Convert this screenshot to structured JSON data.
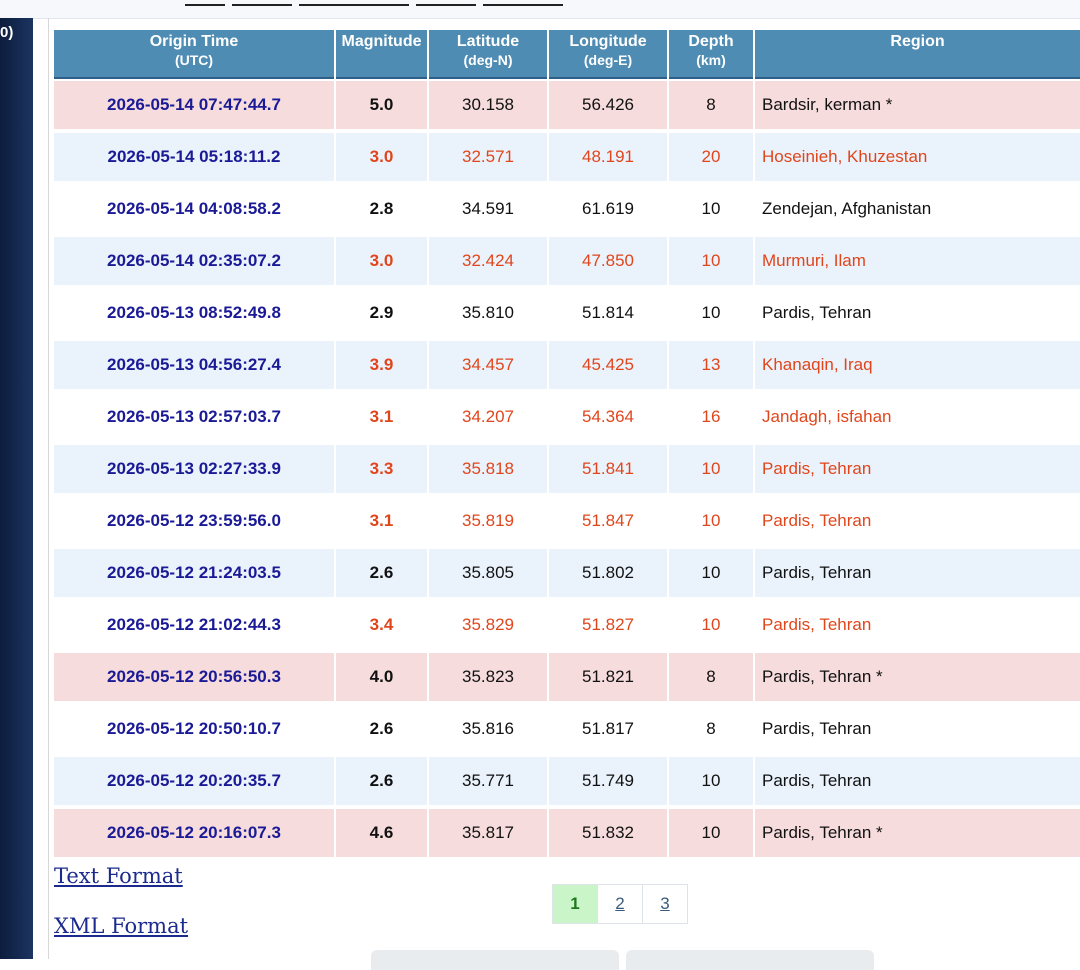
{
  "sidebar": {
    "corner_label": "0)"
  },
  "table": {
    "headers": {
      "time": "Origin Time",
      "time_unit": "(UTC)",
      "magnitude": "Magnitude",
      "latitude": "Latitude",
      "latitude_unit": "(deg-N)",
      "longitude": "Longitude",
      "longitude_unit": "(deg-E)",
      "depth": "Depth",
      "depth_unit": "(km)",
      "region": "Region"
    },
    "rows": [
      {
        "time": "2026-05-14 07:47:44.7",
        "mag": "5.0",
        "lat": "30.158",
        "lon": "56.426",
        "depth": "8",
        "region": "Bardsir, kerman *",
        "style": "big"
      },
      {
        "time": "2026-05-14 05:18:11.2",
        "mag": "3.0",
        "lat": "32.571",
        "lon": "48.191",
        "depth": "20",
        "region": "Hoseinieh, Khuzestan",
        "style": "alt orange"
      },
      {
        "time": "2026-05-14 04:08:58.2",
        "mag": "2.8",
        "lat": "34.591",
        "lon": "61.619",
        "depth": "10",
        "region": "Zendejan, Afghanistan",
        "style": "plain"
      },
      {
        "time": "2026-05-14 02:35:07.2",
        "mag": "3.0",
        "lat": "32.424",
        "lon": "47.850",
        "depth": "10",
        "region": "Murmuri, Ilam",
        "style": "alt orange"
      },
      {
        "time": "2026-05-13 08:52:49.8",
        "mag": "2.9",
        "lat": "35.810",
        "lon": "51.814",
        "depth": "10",
        "region": "Pardis, Tehran",
        "style": "plain"
      },
      {
        "time": "2026-05-13 04:56:27.4",
        "mag": "3.9",
        "lat": "34.457",
        "lon": "45.425",
        "depth": "13",
        "region": "Khanaqin, Iraq",
        "style": "alt orange"
      },
      {
        "time": "2026-05-13 02:57:03.7",
        "mag": "3.1",
        "lat": "34.207",
        "lon": "54.364",
        "depth": "16",
        "region": "Jandagh, isfahan",
        "style": "plain orange"
      },
      {
        "time": "2026-05-13 02:27:33.9",
        "mag": "3.3",
        "lat": "35.818",
        "lon": "51.841",
        "depth": "10",
        "region": "Pardis, Tehran",
        "style": "alt orange"
      },
      {
        "time": "2026-05-12 23:59:56.0",
        "mag": "3.1",
        "lat": "35.819",
        "lon": "51.847",
        "depth": "10",
        "region": "Pardis, Tehran",
        "style": "plain orange"
      },
      {
        "time": "2026-05-12 21:24:03.5",
        "mag": "2.6",
        "lat": "35.805",
        "lon": "51.802",
        "depth": "10",
        "region": "Pardis, Tehran",
        "style": "alt"
      },
      {
        "time": "2026-05-12 21:02:44.3",
        "mag": "3.4",
        "lat": "35.829",
        "lon": "51.827",
        "depth": "10",
        "region": "Pardis, Tehran",
        "style": "plain orange"
      },
      {
        "time": "2026-05-12 20:56:50.3",
        "mag": "4.0",
        "lat": "35.823",
        "lon": "51.821",
        "depth": "8",
        "region": "Pardis, Tehran *",
        "style": "big"
      },
      {
        "time": "2026-05-12 20:50:10.7",
        "mag": "2.6",
        "lat": "35.816",
        "lon": "51.817",
        "depth": "8",
        "region": "Pardis, Tehran",
        "style": "plain"
      },
      {
        "time": "2026-05-12 20:20:35.7",
        "mag": "2.6",
        "lat": "35.771",
        "lon": "51.749",
        "depth": "10",
        "region": "Pardis, Tehran",
        "style": "alt"
      },
      {
        "time": "2026-05-12 20:16:07.3",
        "mag": "4.6",
        "lat": "35.817",
        "lon": "51.832",
        "depth": "10",
        "region": "Pardis, Tehran *",
        "style": "big"
      }
    ]
  },
  "links": {
    "text_format": "Text Format",
    "xml_format": "XML Format"
  },
  "pagination": {
    "pages": [
      "1",
      "2",
      "3"
    ],
    "active": "1"
  },
  "colors": {
    "header_bg": "#4f8cb3",
    "big_row": "#f6dcdc",
    "alt_row": "#eaf2fc",
    "orange_text": "#e0461c",
    "time_text": "#1a1a96"
  }
}
